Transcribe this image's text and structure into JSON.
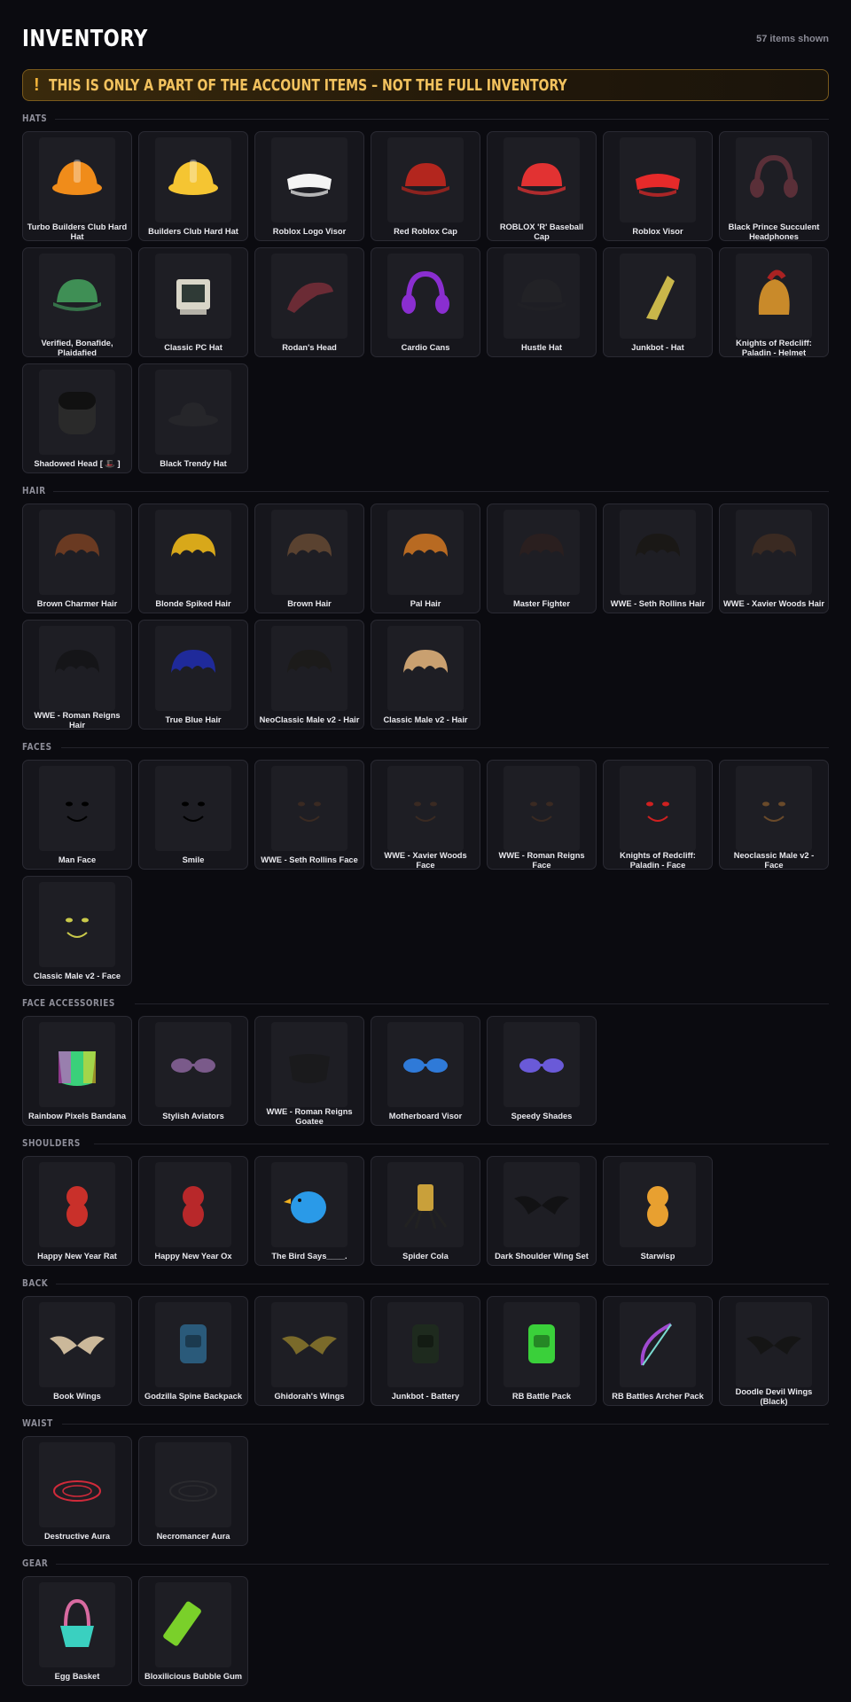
{
  "header": {
    "title": "INVENTORY",
    "count": "57 items shown"
  },
  "warning": {
    "icon": "!",
    "text": "THIS IS ONLY A PART OF THE ACCOUNT ITEMS – NOT THE FULL INVENTORY"
  },
  "sections": [
    {
      "label": "HATS",
      "items": [
        {
          "name": "Turbo Builders Club Hard Hat",
          "icon": "hardhat",
          "color": "#f08c1a"
        },
        {
          "name": "Builders Club Hard Hat",
          "icon": "hardhat",
          "color": "#f5c532"
        },
        {
          "name": "Roblox Logo Visor",
          "icon": "visor",
          "color": "#f4f4f4"
        },
        {
          "name": "Red Roblox Cap",
          "icon": "cap",
          "color": "#b3261e"
        },
        {
          "name": "ROBLOX 'R' Baseball Cap",
          "icon": "cap",
          "color": "#e23232"
        },
        {
          "name": "Roblox Visor",
          "icon": "visor",
          "color": "#e62a2a"
        },
        {
          "name": "Black Prince Succulent Headphones",
          "icon": "headphones",
          "color": "#5a2f38"
        },
        {
          "name": "Verified, Bonafide, Plaidafied",
          "icon": "cap",
          "color": "#3f8f55"
        },
        {
          "name": "Classic PC Hat",
          "icon": "pc",
          "color": "#d9d6c8"
        },
        {
          "name": "Rodan's Head",
          "icon": "creature",
          "color": "#6b2b35"
        },
        {
          "name": "Cardio Cans",
          "icon": "headphones",
          "color": "#8a2ed0"
        },
        {
          "name": "Hustle Hat",
          "icon": "cap",
          "color": "#222226"
        },
        {
          "name": "Junkbot - Hat",
          "icon": "cone",
          "color": "#c9b64a"
        },
        {
          "name": "Knights of Redcliff: Paladin - Helmet",
          "icon": "helmet",
          "color": "#c98a2a"
        },
        {
          "name": "Shadowed Head [ 🎩 ]",
          "icon": "head",
          "color": "#2a2a2a"
        },
        {
          "name": "Black Trendy Hat",
          "icon": "fedora",
          "color": "#26262a"
        }
      ]
    },
    {
      "label": "HAIR",
      "items": [
        {
          "name": "Brown Charmer Hair",
          "icon": "hair",
          "color": "#6a3a22"
        },
        {
          "name": "Blonde Spiked Hair",
          "icon": "hair",
          "color": "#d8a81a"
        },
        {
          "name": "Brown Hair",
          "icon": "hair",
          "color": "#5a4230"
        },
        {
          "name": "Pal Hair",
          "icon": "hair",
          "color": "#b86a22"
        },
        {
          "name": "Master Fighter",
          "icon": "hair",
          "color": "#2a1f1f"
        },
        {
          "name": "WWE - Seth Rollins Hair",
          "icon": "hair",
          "color": "#1a1816"
        },
        {
          "name": "WWE - Xavier Woods Hair",
          "icon": "hair",
          "color": "#3a2a22"
        },
        {
          "name": "WWE - Roman Reigns Hair",
          "icon": "hair",
          "color": "#151518"
        },
        {
          "name": "True Blue Hair",
          "icon": "hair",
          "color": "#1f2a9a"
        },
        {
          "name": "NeoClassic Male v2 - Hair",
          "icon": "hair",
          "color": "#1c1b1a"
        },
        {
          "name": "Classic Male v2 - Hair",
          "icon": "hair",
          "color": "#c9a070"
        }
      ]
    },
    {
      "label": "FACES",
      "items": [
        {
          "name": "Man Face",
          "icon": "face",
          "color": "#000000"
        },
        {
          "name": "Smile",
          "icon": "face",
          "color": "#000000"
        },
        {
          "name": "WWE - Seth Rollins Face",
          "icon": "face",
          "color": "#3a2a22"
        },
        {
          "name": "WWE - Xavier Woods Face",
          "icon": "face",
          "color": "#3a2a22"
        },
        {
          "name": "WWE - Roman Reigns Face",
          "icon": "face",
          "color": "#3a2a22"
        },
        {
          "name": "Knights of Redcliff: Paladin - Face",
          "icon": "face",
          "color": "#d02020"
        },
        {
          "name": "Neoclassic Male v2 - Face",
          "icon": "face",
          "color": "#6a4a2a"
        },
        {
          "name": "Classic Male v2 - Face",
          "icon": "face",
          "color": "#c9c94a"
        }
      ]
    },
    {
      "label": "FACE ACCESSORIES",
      "items": [
        {
          "name": "Rainbow Pixels Bandana",
          "icon": "bandana",
          "color": "#3ad07a"
        },
        {
          "name": "Stylish Aviators",
          "icon": "glasses",
          "color": "#7a5a8a"
        },
        {
          "name": "WWE - Roman Reigns Goatee",
          "icon": "goatee",
          "color": "#1a1a1c"
        },
        {
          "name": "Motherboard Visor",
          "icon": "glasses",
          "color": "#2f7ad8"
        },
        {
          "name": "Speedy Shades",
          "icon": "glasses",
          "color": "#6a5ad8"
        }
      ]
    },
    {
      "label": "SHOULDERS",
      "items": [
        {
          "name": "Happy New Year Rat",
          "icon": "pet",
          "color": "#c9302a"
        },
        {
          "name": "Happy New Year Ox",
          "icon": "pet",
          "color": "#b8282a"
        },
        {
          "name": "The Bird Says____.",
          "icon": "bird",
          "color": "#2a9ae8"
        },
        {
          "name": "Spider Cola",
          "icon": "can",
          "color": "#c9a03a"
        },
        {
          "name": "Dark Shoulder Wing Set",
          "icon": "wings",
          "color": "#121214"
        },
        {
          "name": "Starwisp",
          "icon": "pet",
          "color": "#e8a030"
        }
      ]
    },
    {
      "label": "BACK",
      "items": [
        {
          "name": "Book Wings",
          "icon": "wings",
          "color": "#cbb89a"
        },
        {
          "name": "Godzilla Spine Backpack",
          "icon": "backpack",
          "color": "#2a5a7a"
        },
        {
          "name": "Ghidorah's Wings",
          "icon": "wings",
          "color": "#7a6a2a"
        },
        {
          "name": "Junkbot - Battery",
          "icon": "backpack",
          "color": "#1e2a1e"
        },
        {
          "name": "RB Battle Pack",
          "icon": "backpack",
          "color": "#3ad03a"
        },
        {
          "name": "RB Battles Archer Pack",
          "icon": "bow",
          "color": "#a04ad0"
        },
        {
          "name": "Doodle Devil Wings (Black)",
          "icon": "wings",
          "color": "#151515"
        }
      ]
    },
    {
      "label": "WAIST",
      "items": [
        {
          "name": "Destructive Aura",
          "icon": "aura",
          "color": "#d02a3a"
        },
        {
          "name": "Necromancer Aura",
          "icon": "aura",
          "color": "#2a2a2e"
        }
      ]
    },
    {
      "label": "GEAR",
      "items": [
        {
          "name": "Egg Basket",
          "icon": "basket",
          "color": "#d86aa0"
        },
        {
          "name": "Bloxilicious Bubble Gum",
          "icon": "gum",
          "color": "#7ad02a"
        }
      ]
    }
  ]
}
